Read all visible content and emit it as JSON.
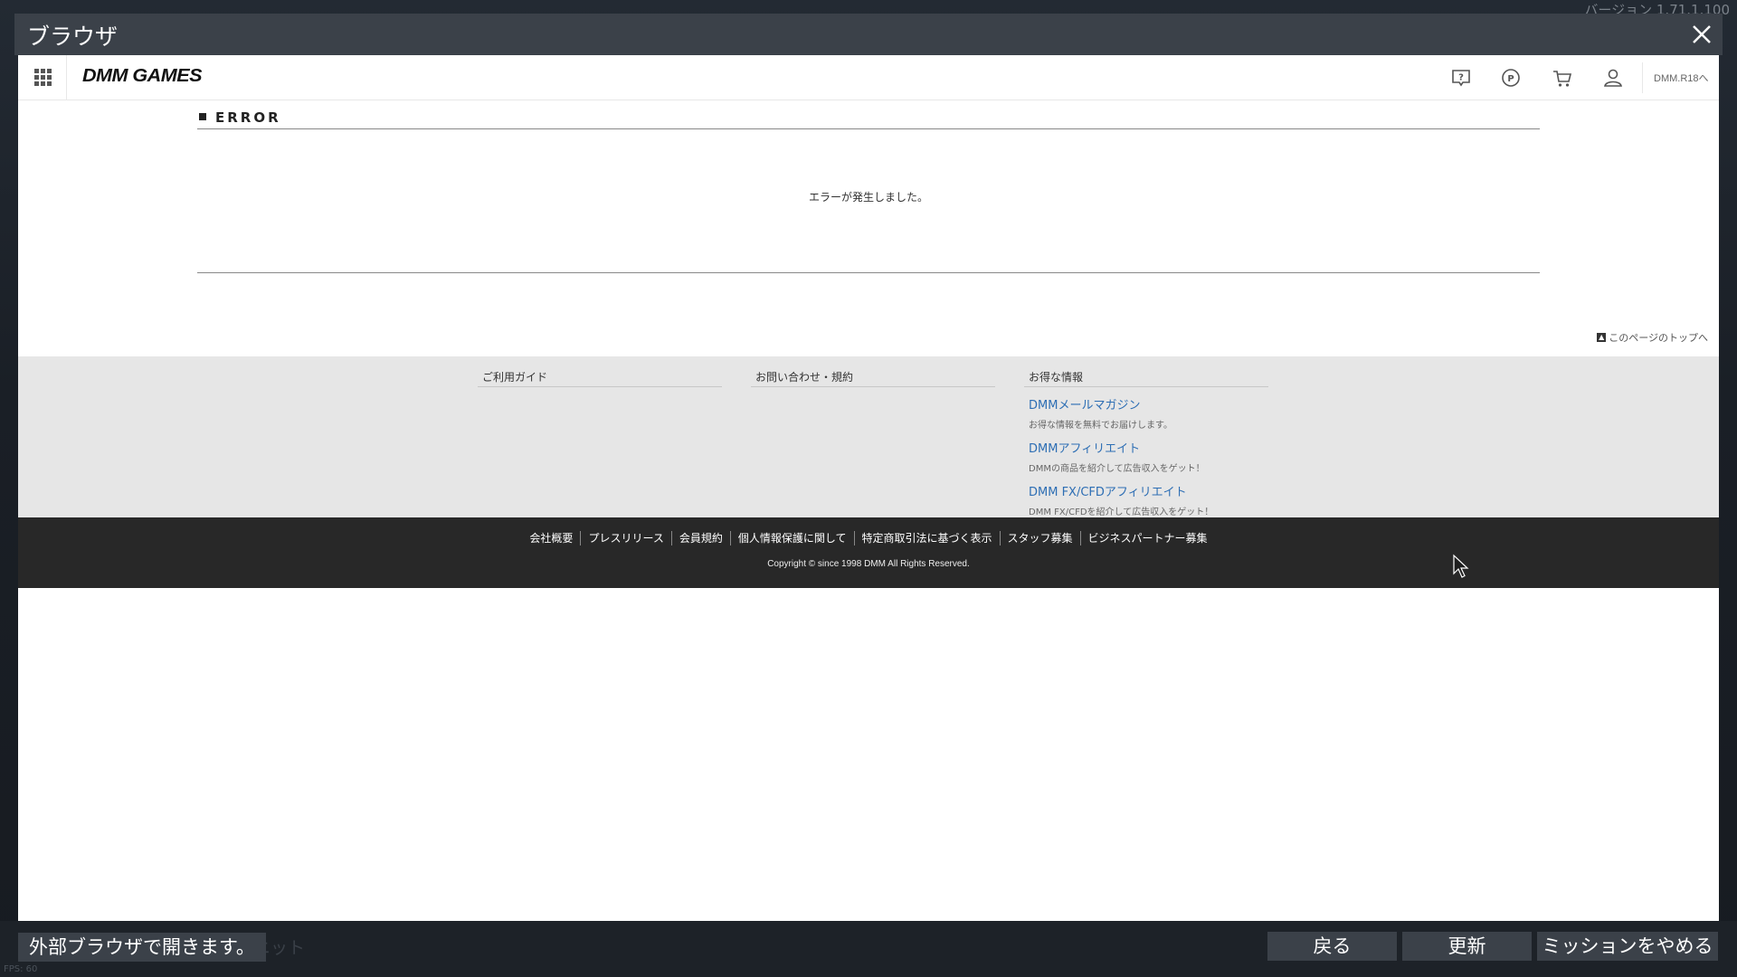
{
  "overlay": {
    "title": "ブラウザ",
    "version": "バージョン 1.71.1.100",
    "fps": "FPS: 60"
  },
  "site": {
    "logo": "DMM GAMES",
    "header_icons": [
      "help-icon",
      "point-icon",
      "cart-icon",
      "user-icon"
    ],
    "r18_link": "DMM.R18へ"
  },
  "error": {
    "heading": "ERROR",
    "message": "エラーが発生しました。"
  },
  "page_top": "このページのトップへ",
  "footer_info": {
    "col1": {
      "title": "ご利用ガイド"
    },
    "col2": {
      "title": "お問い合わせ・規約"
    },
    "col3": {
      "title": "お得な情報",
      "items": [
        {
          "label": "DMMメールマガジン",
          "desc": "お得な情報を無料でお届けします。"
        },
        {
          "label": "DMMアフィリエイト",
          "desc": "DMMの商品を紹介して広告収入をゲット！"
        },
        {
          "label": "DMM FX/CFDアフィリエイト",
          "desc": "DMM FX/CFDを紹介して広告収入をゲット！"
        }
      ]
    }
  },
  "footer_links": [
    "会社概要",
    "プレスリリース",
    "会員規約",
    "個人情報保護に関して",
    "特定商取引法に基づく表示",
    "スタッフ募集",
    "ビジネスパートナー募集"
  ],
  "copyright": "Copyright © since 1998 DMM All Rights Reserved.",
  "bottom": {
    "notice": "外部ブラウザで開きます。",
    "ghost": "ニット",
    "back": "戻る",
    "refresh": "更新",
    "quit_mission": "ミッションをやめる"
  },
  "colors": {
    "link": "#2d6eb4",
    "footer_dark": "#282828",
    "footer_light": "#e6e6e6",
    "overlay_bar": "#3b4149"
  }
}
